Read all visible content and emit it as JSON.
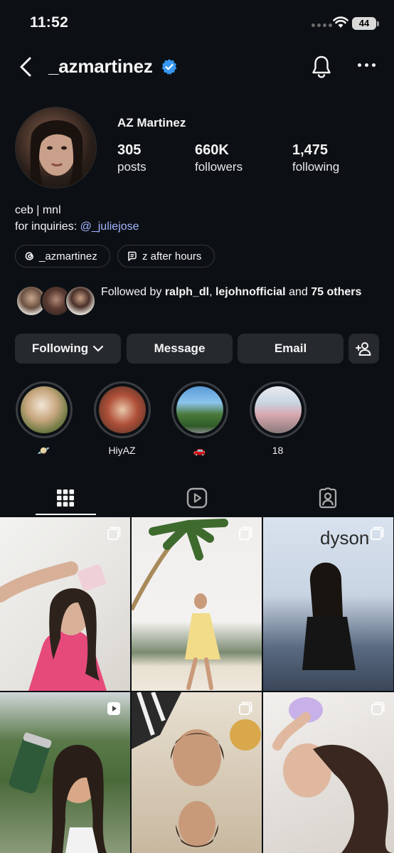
{
  "status_bar": {
    "time": "11:52",
    "battery": "44"
  },
  "header": {
    "username": "_azmartinez",
    "verified": true
  },
  "profile": {
    "display_name": "AZ Martinez",
    "stats": [
      {
        "value": "305",
        "label": "posts"
      },
      {
        "value": "660K",
        "label": "followers"
      },
      {
        "value": "1,475",
        "label": "following"
      }
    ],
    "bio_line1": "ceb | mnl",
    "bio_prefix": "for inquiries: ",
    "bio_mention": "@_juliejose"
  },
  "chips": [
    {
      "label": "_azmartinez",
      "icon": "threads-icon"
    },
    {
      "label": "z after hours",
      "icon": "channel-icon"
    }
  ],
  "followed_by": {
    "prefix": "Followed by ",
    "user1": "ralph_dl",
    "sep": ", ",
    "user2": "lejohnofficial",
    "mid": " and ",
    "rest": "75 others"
  },
  "actions": {
    "following": "Following",
    "message": "Message",
    "email": "Email"
  },
  "highlights": [
    {
      "label": "🪐"
    },
    {
      "label": "HiyAZ"
    },
    {
      "label": "🚗"
    },
    {
      "label": "18"
    }
  ],
  "tabs": [
    "grid-icon",
    "reels-icon",
    "tagged-icon"
  ],
  "colors": {
    "background": "#0c1014",
    "button": "#262a2f",
    "mention": "#a3b4ff",
    "verified": "#3897f0"
  }
}
